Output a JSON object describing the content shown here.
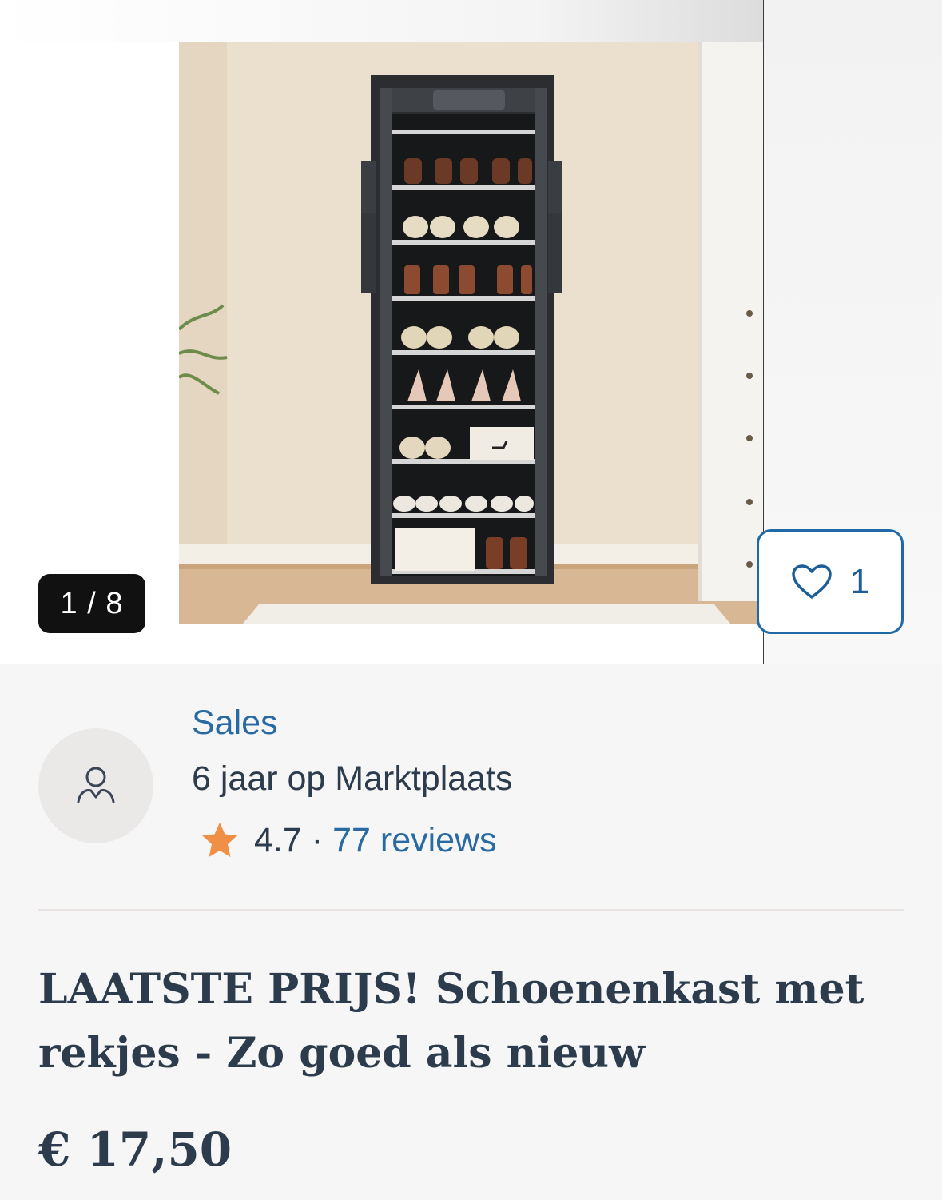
{
  "gallery": {
    "counter": "1 / 8",
    "favorite_count": "1",
    "image_alt": "Schoenenkast met rekjes"
  },
  "seller": {
    "name": "Sales",
    "tenure": "6 jaar op Marktplaats",
    "rating": "4.7",
    "separator": "·",
    "reviews": "77 reviews"
  },
  "listing": {
    "title": "LAATSTE PRIJS! Schoenenkast met rekjes - Zo goed als nieuw",
    "price": "€ 17,50"
  },
  "colors": {
    "link": "#2a6aa3",
    "text": "#2d3c4d",
    "star": "#f08f46",
    "fav_border": "#1f6aa6"
  }
}
